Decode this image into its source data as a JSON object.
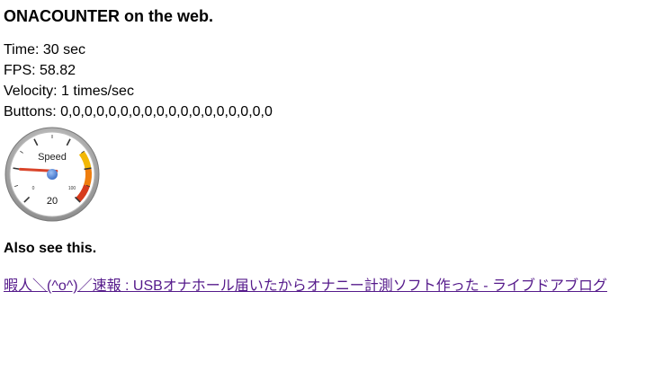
{
  "header": {
    "title": "ONACOUNTER on the web."
  },
  "stats": {
    "time": "Time: 30 sec",
    "fps": "FPS: 58.82",
    "velocity": "Velocity: 1 times/sec",
    "buttons": "Buttons: 0,0,0,0,0,0,0,0,0,0,0,0,0,0,0,0,0,0"
  },
  "gauge": {
    "label": "Speed",
    "value": 20,
    "value_text": "20",
    "min": 0,
    "max": 100,
    "min_label": "0",
    "max_label": "100",
    "colors": {
      "needle": "#d9442a",
      "hub": "#4a7fd4",
      "yellow_band": "#f2b705",
      "orange_band": "#ef7d0d",
      "red_band": "#d63a1c",
      "face": "#ffffff",
      "rim": "#9a9a9a"
    }
  },
  "related": {
    "heading": "Also see this.",
    "link_text": "暇人＼(^o^)／速報 : USBオナホール届いたからオナニー計測ソフト作った - ライブドアブログ"
  }
}
